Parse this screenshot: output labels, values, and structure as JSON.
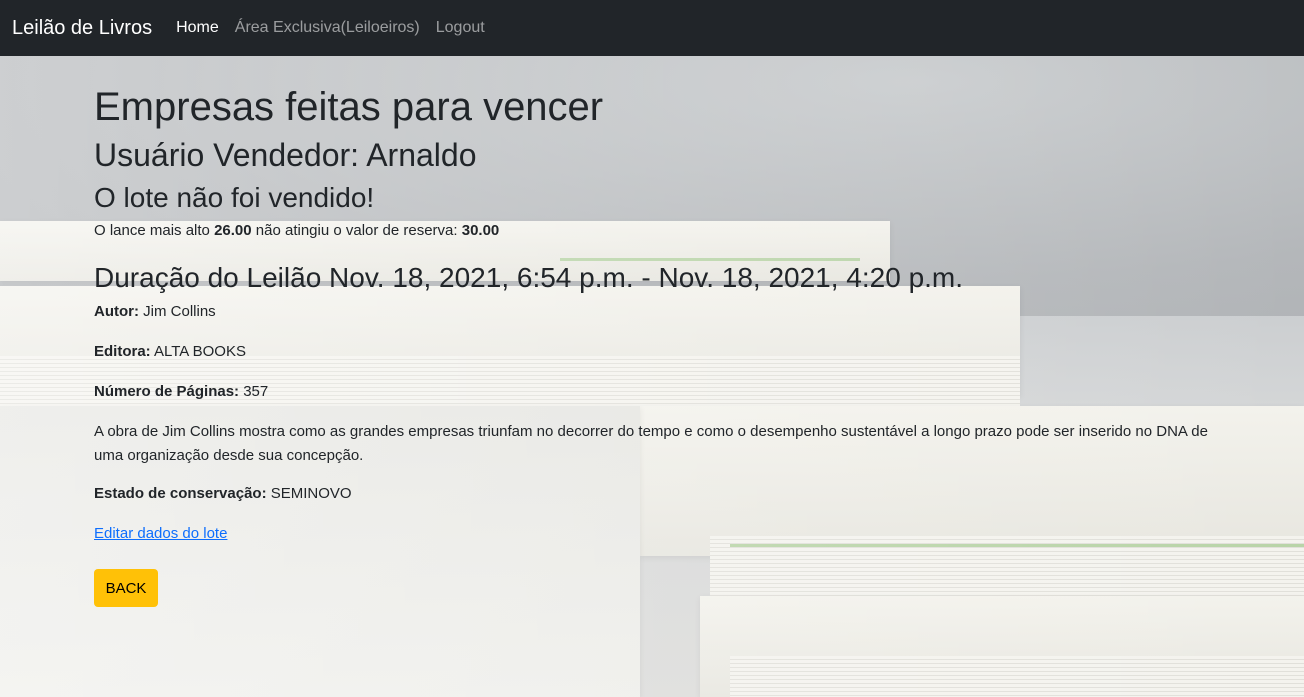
{
  "navbar": {
    "brand": "Leilão de Livros",
    "links": [
      {
        "label": "Home",
        "active": true
      },
      {
        "label": "Área Exclusiva(Leiloeiros)",
        "active": false
      },
      {
        "label": "Logout",
        "active": false
      }
    ]
  },
  "lot": {
    "title": "Empresas feitas para vencer",
    "seller_heading": "Usuário Vendedor: Arnaldo",
    "status_heading": "O lote não foi vendido!",
    "bid_text_before": "O lance mais alto ",
    "highest_bid": "26.00",
    "bid_text_middle": " não atingiu o valor de reserva: ",
    "reserve_value": "30.00",
    "duration_heading": "Duração do Leilão Nov. 18, 2021, 6:54 p.m. - Nov. 18, 2021, 4:20 p.m.",
    "author_label": "Autor:",
    "author_value": " Jim Collins",
    "publisher_label": "Editora:",
    "publisher_value": " ALTA BOOKS",
    "pages_label": "Número de Páginas:",
    "pages_value": " 357",
    "description": "A obra de Jim Collins mostra como as grandes empresas triunfam no decorrer do tempo e como o desempenho sustentável a longo prazo pode ser inserido no DNA de uma organização desde sua concepção.",
    "condition_label": "Estado de conservação:",
    "condition_value": " SEMINOVO",
    "edit_link": "Editar dados do lote",
    "back_button": "BACK"
  },
  "colors": {
    "navbar_bg": "#212529",
    "link": "#0d6efd",
    "back_button_bg": "#ffc107"
  }
}
